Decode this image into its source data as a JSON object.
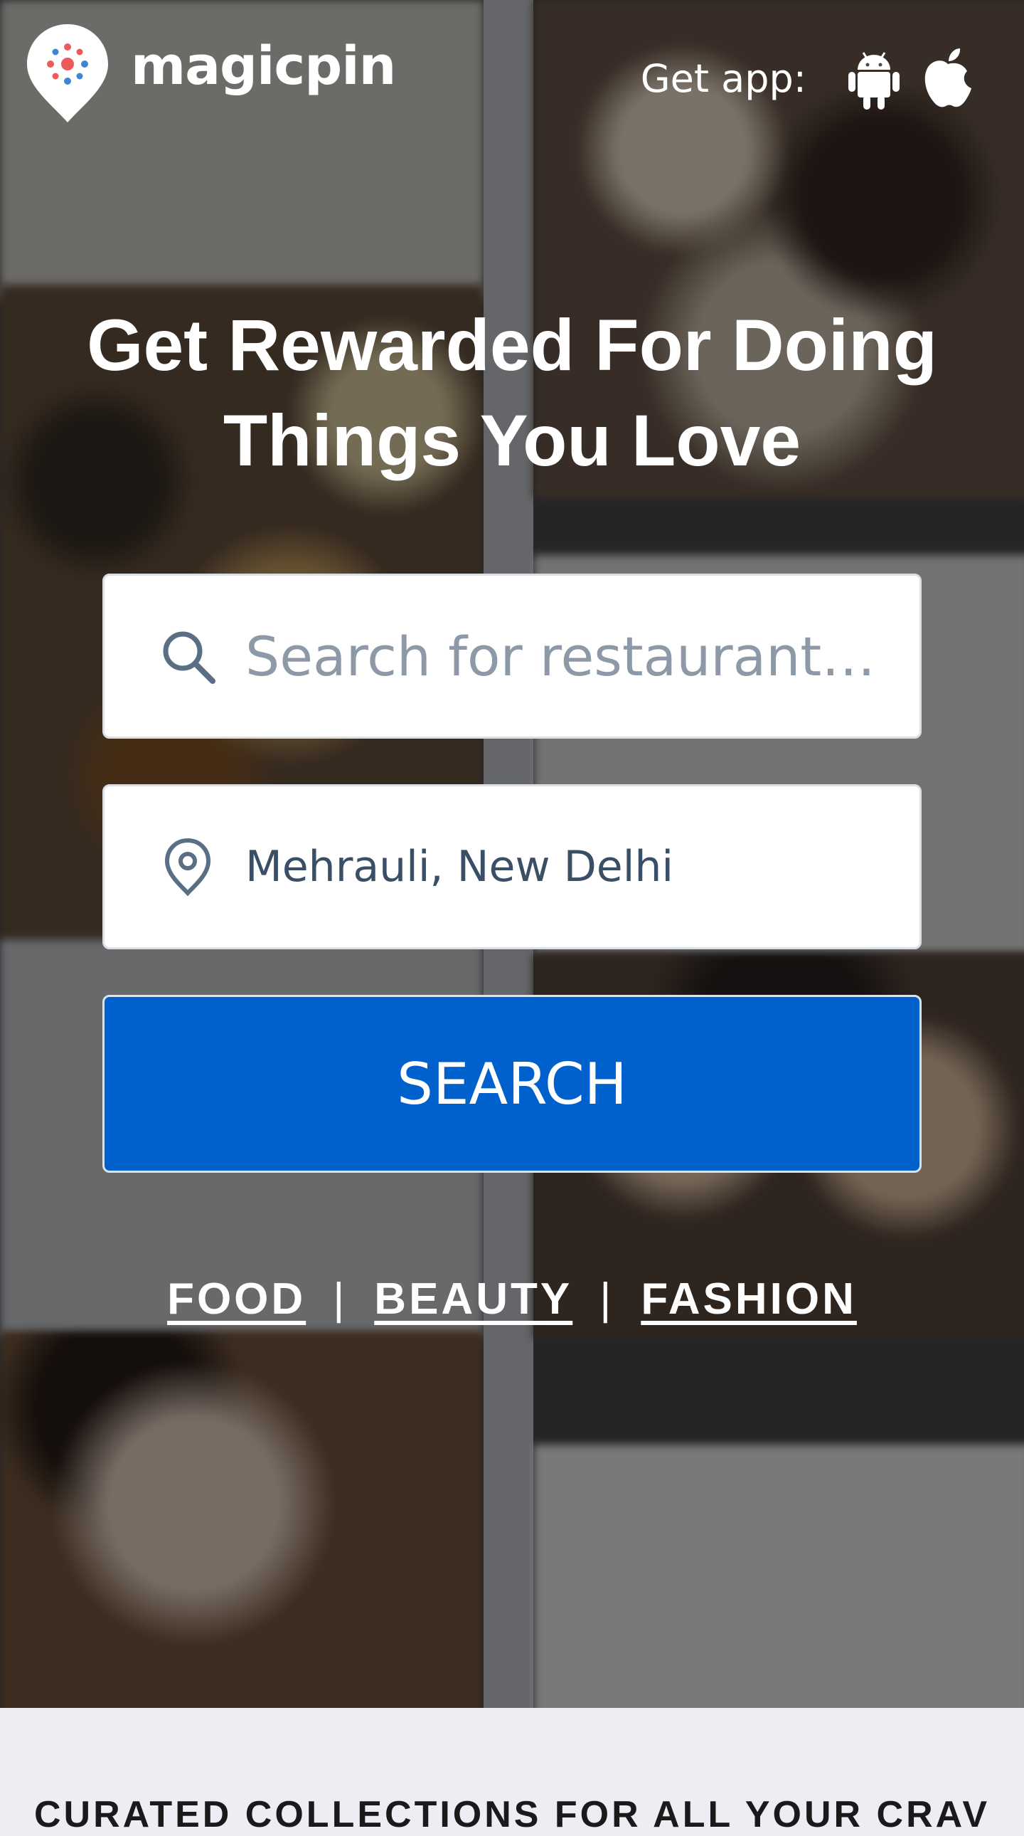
{
  "header": {
    "brand": "magicpin",
    "get_app_label": "Get app:",
    "android_icon": "android-icon",
    "apple_icon": "apple-icon"
  },
  "hero": {
    "headline_line1": "Get Rewarded For Doing",
    "headline_line2": "Things You Love"
  },
  "search": {
    "placeholder": "Search for restaurants, ...",
    "icon": "search-icon"
  },
  "location": {
    "value": "Mehrauli, New Delhi",
    "icon": "location-pin-icon"
  },
  "search_button": {
    "label": "SEARCH"
  },
  "categories": [
    {
      "label": "FOOD"
    },
    {
      "label": "BEAUTY"
    },
    {
      "label": "FASHION"
    }
  ],
  "category_separator": "|",
  "collections": {
    "title": "CURATED COLLECTIONS FOR ALL YOUR CRAV"
  },
  "colors": {
    "accent": "#0061cc",
    "logo_pin": "#ffffff",
    "logo_dot_red": "#ee5a5a",
    "logo_dot_blue": "#3d86d6",
    "footer_bg": "#eceef3"
  }
}
